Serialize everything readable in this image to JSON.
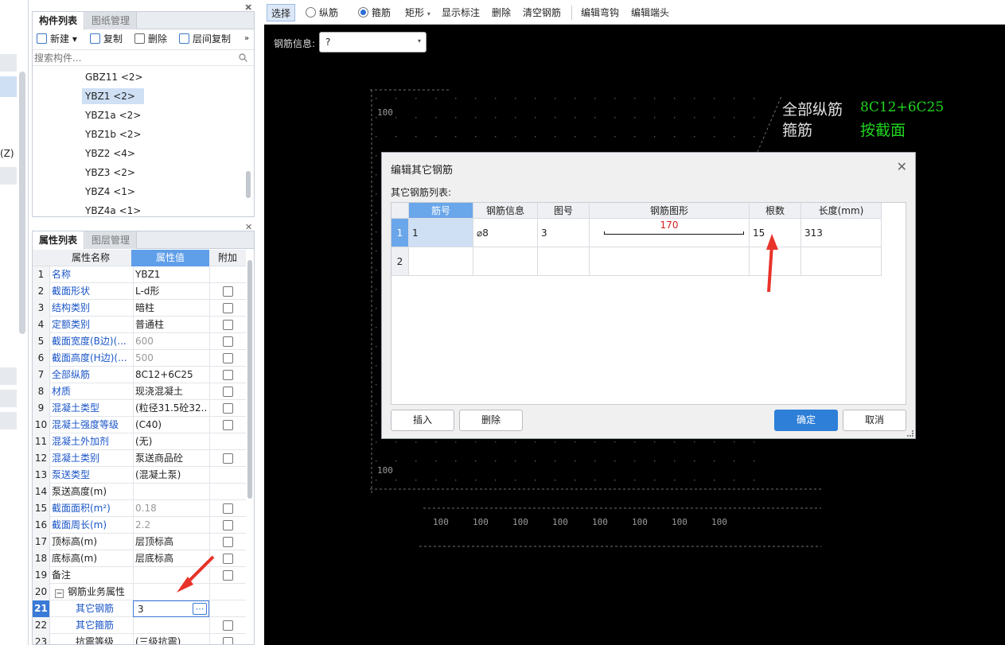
{
  "left_strip": {
    "label": "(Z)"
  },
  "component_panel": {
    "tabs": [
      "构件列表",
      "图纸管理"
    ],
    "toolbar": {
      "new": "新建",
      "copy": "复制",
      "delete": "删除",
      "floor_copy": "层间复制",
      "more": "»"
    },
    "search_placeholder": "搜索构件...",
    "items": [
      "GBZ11 <2>",
      "YBZ1 <2>",
      "YBZ1a <2>",
      "YBZ1b <2>",
      "YBZ2 <4>",
      "YBZ3 <2>",
      "YBZ4 <1>",
      "YBZ4a <1>"
    ],
    "selected_item": "YBZ1 <2>"
  },
  "property_panel": {
    "tabs": [
      "属性列表",
      "图层管理"
    ],
    "headers": {
      "name": "属性名称",
      "value": "属性值",
      "extra": "附加"
    },
    "rows": [
      {
        "no": "1",
        "name": "名称",
        "value": "YBZ1",
        "blue": true,
        "gray": false,
        "checkbox": false
      },
      {
        "no": "2",
        "name": "截面形状",
        "value": "L-d形",
        "blue": true,
        "gray": false,
        "checkbox": true
      },
      {
        "no": "3",
        "name": "结构类别",
        "value": "暗柱",
        "blue": true,
        "gray": false,
        "checkbox": true
      },
      {
        "no": "4",
        "name": "定额类别",
        "value": "普通柱",
        "blue": true,
        "gray": false,
        "checkbox": true
      },
      {
        "no": "5",
        "name": "截面宽度(B边)(...",
        "value": "600",
        "blue": true,
        "gray": true,
        "checkbox": true
      },
      {
        "no": "6",
        "name": "截面高度(H边)(...",
        "value": "500",
        "blue": true,
        "gray": true,
        "checkbox": true
      },
      {
        "no": "7",
        "name": "全部纵筋",
        "value": "8C12+6C25",
        "blue": true,
        "gray": false,
        "checkbox": true
      },
      {
        "no": "8",
        "name": "材质",
        "value": "现浇混凝土",
        "blue": true,
        "gray": false,
        "checkbox": true
      },
      {
        "no": "9",
        "name": "混凝土类型",
        "value": "(粒径31.5砼32....",
        "blue": true,
        "gray": false,
        "checkbox": true
      },
      {
        "no": "10",
        "name": "混凝土强度等级",
        "value": "(C40)",
        "blue": true,
        "gray": false,
        "checkbox": true
      },
      {
        "no": "11",
        "name": "混凝土外加剂",
        "value": "(无)",
        "blue": true,
        "gray": false,
        "checkbox": false
      },
      {
        "no": "12",
        "name": "混凝土类别",
        "value": "泵送商品砼",
        "blue": true,
        "gray": false,
        "checkbox": true
      },
      {
        "no": "13",
        "name": "泵送类型",
        "value": "(混凝土泵)",
        "blue": true,
        "gray": false,
        "checkbox": false
      },
      {
        "no": "14",
        "name": "泵送高度(m)",
        "value": "",
        "blue": false,
        "gray": false,
        "checkbox": false
      },
      {
        "no": "15",
        "name": "截面面积(m²)",
        "value": "0.18",
        "blue": true,
        "gray": true,
        "checkbox": true
      },
      {
        "no": "16",
        "name": "截面周长(m)",
        "value": "2.2",
        "blue": true,
        "gray": true,
        "checkbox": true
      },
      {
        "no": "17",
        "name": "顶标高(m)",
        "value": "层顶标高",
        "blue": false,
        "gray": false,
        "checkbox": true
      },
      {
        "no": "18",
        "name": "底标高(m)",
        "value": "层底标高",
        "blue": false,
        "gray": false,
        "checkbox": true
      },
      {
        "no": "19",
        "name": "备注",
        "value": "",
        "blue": false,
        "gray": false,
        "checkbox": true
      },
      {
        "no": "20",
        "name": "钢筋业务属性",
        "value": "",
        "blue": false,
        "gray": false,
        "checkbox": false
      },
      {
        "no": "21",
        "name": "其它钢筋",
        "value": "3",
        "blue": true,
        "gray": false,
        "checkbox": false
      },
      {
        "no": "22",
        "name": "其它箍筋",
        "value": "",
        "blue": true,
        "gray": false,
        "checkbox": true
      },
      {
        "no": "23",
        "name": "抗震等级",
        "value": "(三级抗震)",
        "blue": false,
        "gray": false,
        "checkbox": true
      }
    ],
    "expand_symbol": "−",
    "ellipsis": "⋯"
  },
  "cad_toolbar": {
    "select": "选择",
    "longitudinal": "纵筋",
    "stirrup": "箍筋",
    "rect": "矩形",
    "show_label": "显示标注",
    "delete": "删除",
    "clear": "清空钢筋",
    "edit_hook": "编辑弯钩",
    "edit_end": "编辑端头"
  },
  "rebar_info": {
    "label": "钢筋信息:",
    "value": "?"
  },
  "canvas_text": {
    "all_long_label": "全部纵筋",
    "all_long_value": "8C12+6C25",
    "stirrup_label": "箍筋",
    "stirrup_value": "按截面",
    "dim_100": "100"
  },
  "dialog": {
    "title": "编辑其它钢筋",
    "list_label": "其它钢筋列表:",
    "columns": [
      "筋号",
      "钢筋信息",
      "图号",
      "钢筋图形",
      "根数",
      "长度(mm)"
    ],
    "rows": [
      {
        "no": "1",
        "bar_no": "1",
        "info": "⌀8",
        "fig": "3",
        "shape_len": "170",
        "count": "15",
        "length": "313"
      },
      {
        "no": "2",
        "bar_no": "",
        "info": "",
        "fig": "",
        "shape_len": "",
        "count": "",
        "length": ""
      }
    ],
    "buttons": {
      "insert": "插入",
      "delete": "删除",
      "ok": "确定",
      "cancel": "取消"
    }
  },
  "colors": {
    "accent": "#3a7ad6",
    "green_text": "#1fd61f",
    "annotation_red": "#e8332a"
  }
}
